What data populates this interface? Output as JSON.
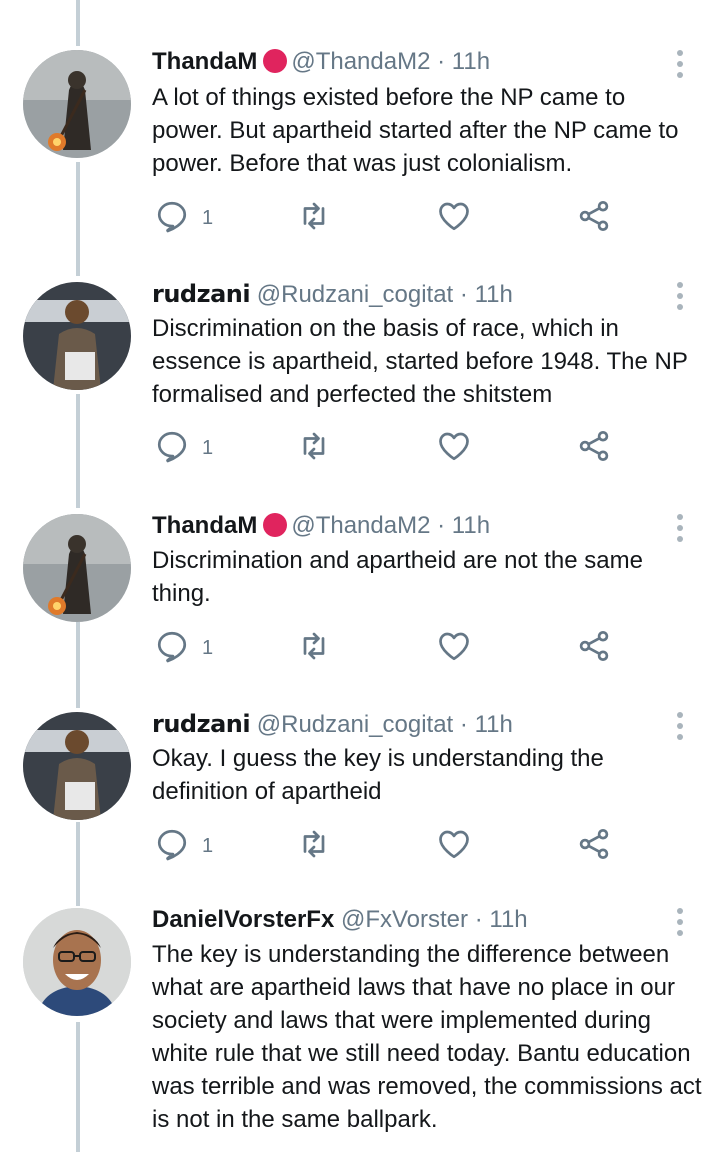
{
  "tweets": [
    {
      "name": "ThandaM",
      "badge": true,
      "handle": "@ThandaM2",
      "sep": "·",
      "time": "11h",
      "text": "A lot of things existed before the NP came to power. But apartheid started after the NP came to power. Before that was just colonialism.",
      "reply_count": "1"
    },
    {
      "name": "rudzani",
      "badge": false,
      "handle": "@Rudzani_cogitat",
      "sep": "·",
      "time": "11h",
      "text": "Discrimination on the basis of race, which in essence is apartheid, started before 1948. The NP formalised and perfected the shitstem",
      "reply_count": "1"
    },
    {
      "name": "ThandaM",
      "badge": true,
      "handle": "@ThandaM2",
      "sep": "·",
      "time": "11h",
      "text": "Discrimination and apartheid are not the same thing.",
      "reply_count": "1"
    },
    {
      "name": "rudzani",
      "badge": false,
      "handle": "@Rudzani_cogitat",
      "sep": "·",
      "time": "11h",
      "text": "Okay. I guess the key is understanding the definition of apartheid",
      "reply_count": "1"
    },
    {
      "name": "DanielVorsterFx",
      "badge": false,
      "handle": "@FxVorster",
      "sep": "·",
      "time": "11h",
      "text": "The key is understanding the difference between what are apartheid laws that have no place in our society and laws that were implemented during white rule that we still need today. Bantu education was terrible and was removed, the commissions act is not in the same ballpark.",
      "reply_count": ""
    }
  ],
  "colors": {
    "badge": "#e0245e",
    "secondary_text": "#657786",
    "thread_line": "#c4cfd6",
    "icon": "#657786"
  },
  "icons": [
    "reply-icon",
    "retweet-icon",
    "like-icon",
    "share-icon",
    "more-icon",
    "badge-icon"
  ]
}
